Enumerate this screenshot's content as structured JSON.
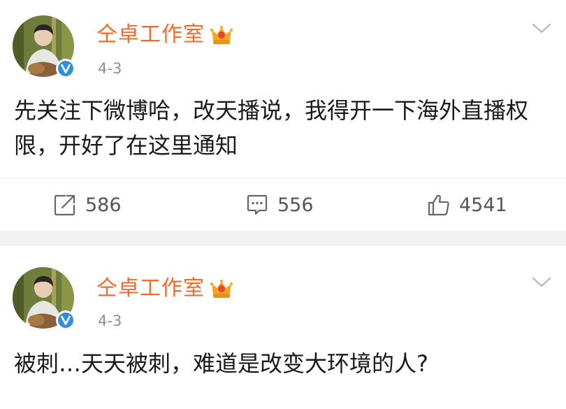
{
  "posts": [
    {
      "author": "仝卓工作室",
      "time": "4-3",
      "text": "先关注下微博哈，改天播说，我得开一下海外直播权限，开好了在这里通知",
      "reposts": "586",
      "comments": "556",
      "likes": "4541"
    },
    {
      "author": "仝卓工作室",
      "time": "4-3",
      "text": "被刺…天天被刺，难道是改变大环境的人?"
    }
  ],
  "icons": {
    "avatar": "avatar-photo",
    "verified": "verified-v-badge-icon",
    "vip": "vip-crown-icon",
    "more": "chevron-down-icon",
    "repost": "repost-icon",
    "comment": "comment-icon",
    "like": "thumbs-up-icon"
  },
  "colors": {
    "author_name": "#f06a2c",
    "verified_badge": "#2f8fd8",
    "vip_crown": "#f5a623",
    "separator": "#f2f2f2",
    "text": "#1a1a1a",
    "meta": "#8e8e8e"
  }
}
